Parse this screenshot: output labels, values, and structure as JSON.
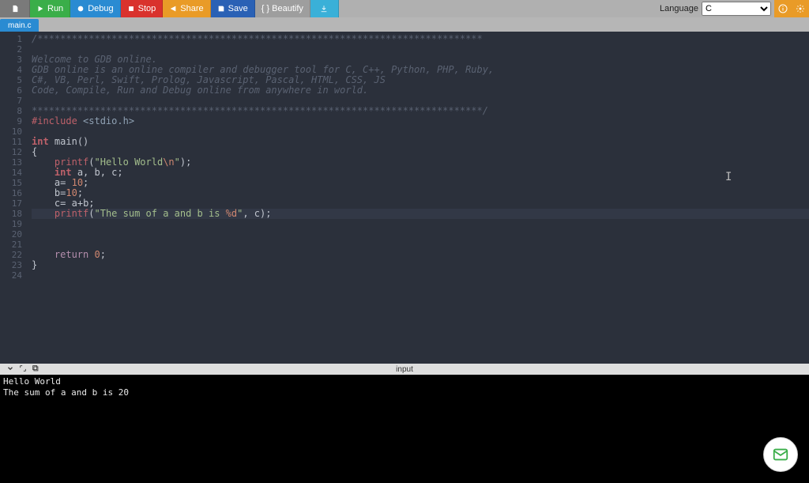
{
  "toolbar": {
    "run": "Run",
    "debug": "Debug",
    "stop": "Stop",
    "share": "Share",
    "save": "Save",
    "beautify": "{ } Beautify",
    "language_label": "Language",
    "language_value": "C"
  },
  "tabs": {
    "file": "main.c"
  },
  "code_lines": [
    [
      [
        "comment",
        "/******************************************************************************"
      ]
    ],
    [],
    [
      [
        "comment",
        "Welcome to GDB online."
      ]
    ],
    [
      [
        "comment",
        "GDB online is an online compiler and debugger tool for C, C++, Python, PHP, Ruby,"
      ]
    ],
    [
      [
        "comment",
        "C#, VB, Perl, Swift, Prolog, Javascript, Pascal, HTML, CSS, JS"
      ]
    ],
    [
      [
        "comment",
        "Code, Compile, Run and Debug online from anywhere in world."
      ]
    ],
    [],
    [
      [
        "comment",
        "*******************************************************************************/"
      ]
    ],
    [
      [
        "pre",
        "#include "
      ],
      [
        "inc",
        "<stdio.h>"
      ]
    ],
    [],
    [
      [
        "type",
        "int"
      ],
      [
        "id",
        " main"
      ],
      [
        "op",
        "()"
      ]
    ],
    [
      [
        "op",
        "{"
      ]
    ],
    [
      [
        "indent",
        "    "
      ],
      [
        "fn",
        "printf"
      ],
      [
        "op",
        "("
      ],
      [
        "str",
        "\"Hello World"
      ],
      [
        "esc",
        "\\n"
      ],
      [
        "str",
        "\""
      ],
      [
        "op",
        ");"
      ]
    ],
    [
      [
        "indent",
        "    "
      ],
      [
        "type",
        "int"
      ],
      [
        "id",
        " a, b, c"
      ],
      [
        "op",
        ";"
      ]
    ],
    [
      [
        "indent",
        "    "
      ],
      [
        "id",
        "a"
      ],
      [
        "op",
        "= "
      ],
      [
        "num",
        "10"
      ],
      [
        "op",
        ";"
      ]
    ],
    [
      [
        "indent",
        "    "
      ],
      [
        "id",
        "b"
      ],
      [
        "op",
        "="
      ],
      [
        "num",
        "10"
      ],
      [
        "op",
        ";"
      ]
    ],
    [
      [
        "indent",
        "    "
      ],
      [
        "id",
        "c"
      ],
      [
        "op",
        "= "
      ],
      [
        "id",
        "a"
      ],
      [
        "op",
        "+"
      ],
      [
        "id",
        "b"
      ],
      [
        "op",
        ";"
      ]
    ],
    [
      [
        "indent",
        "    "
      ],
      [
        "fn",
        "printf"
      ],
      [
        "op",
        "("
      ],
      [
        "str",
        "\"The sum of a and b is "
      ],
      [
        "fmt",
        "%d"
      ],
      [
        "str",
        "\""
      ],
      [
        "op",
        ", c);"
      ]
    ],
    [],
    [],
    [],
    [
      [
        "indent",
        "    "
      ],
      [
        "kw",
        "return"
      ],
      [
        "op",
        " "
      ],
      [
        "num",
        "0"
      ],
      [
        "op",
        ";"
      ]
    ],
    [
      [
        "op",
        "}"
      ]
    ],
    []
  ],
  "highlight_line": 18,
  "bottom_tab": "input",
  "console_output": "Hello World\nThe sum of a and b is 20"
}
